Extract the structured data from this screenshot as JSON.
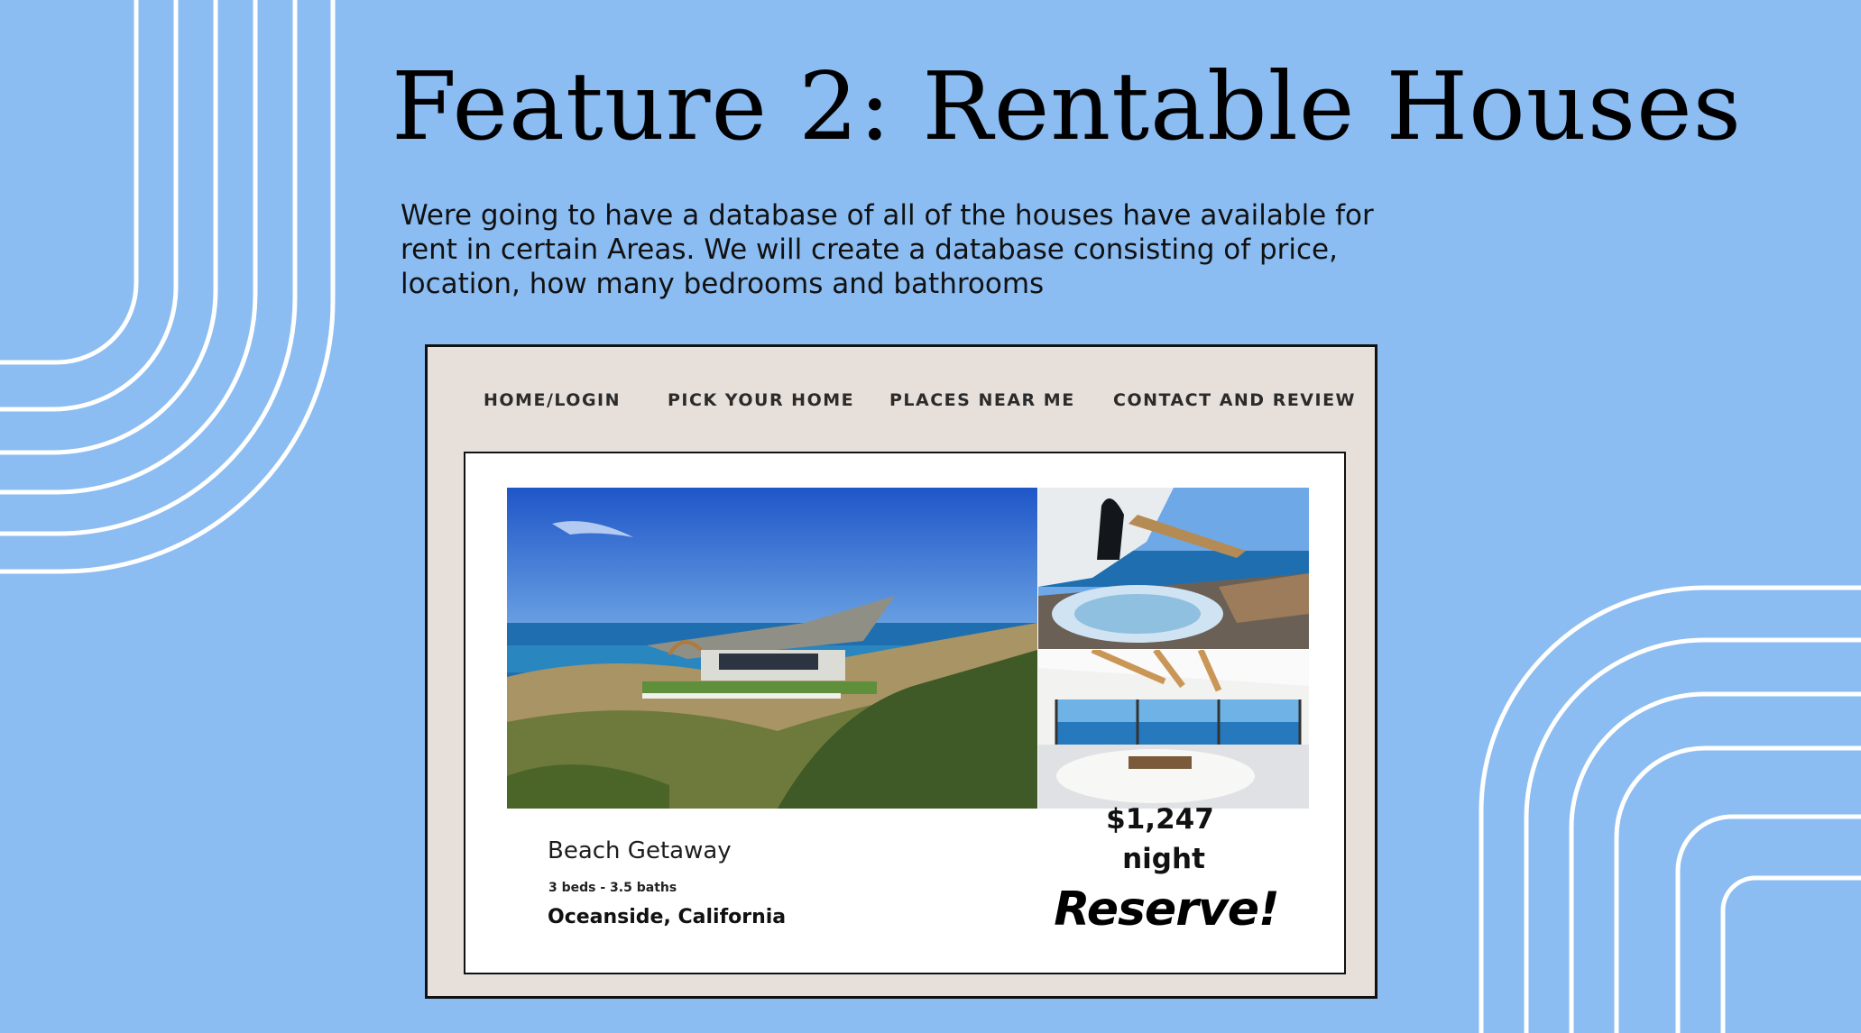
{
  "slide": {
    "title": "Feature 2: Rentable Houses",
    "description": "Were going to have a database of all of the houses have available for rent in certain Areas. We will create a database consisting of price, location, how many bedrooms and bathrooms",
    "background_color": "#8bbcf2",
    "decoration_color": "#ffffff"
  },
  "mockup": {
    "nav": [
      {
        "label": "HOME/LOGIN"
      },
      {
        "label": "PICK YOUR HOME"
      },
      {
        "label": "PLACES NEAR ME"
      },
      {
        "label": "CONTACT AND REVIEW"
      }
    ],
    "listing": {
      "name": "Beach Getaway",
      "specs": "3 beds - 3.5 baths",
      "location": "Oceanside, California",
      "price": "$1,247",
      "per": "night",
      "reserve_label": "Reserve!",
      "photos": [
        "beach-house-exterior",
        "hot-tub-balcony",
        "ocean-view-living-room"
      ]
    },
    "panel_color": "#e6dfda"
  }
}
